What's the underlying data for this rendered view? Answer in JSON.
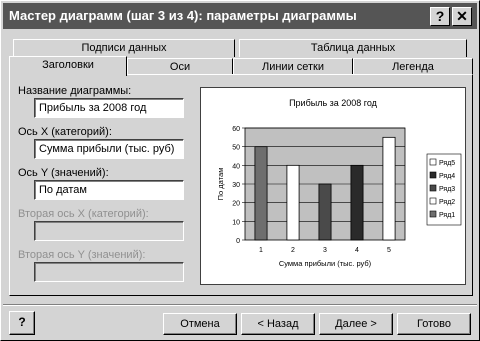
{
  "window": {
    "title": "Мастер диаграмм (шаг 3 из 4): параметры диаграммы",
    "help_btn": "?",
    "close_btn": "✕"
  },
  "tabs_back": [
    "Подписи данных",
    "Таблица данных"
  ],
  "tabs_front": [
    "Заголовки",
    "Оси",
    "Линии сетки",
    "Легенда"
  ],
  "fields": {
    "chart_title": {
      "label": "Название диаграммы:",
      "value": "Прибыль за 2008 год"
    },
    "x_axis": {
      "label": "Ось X (категорий):",
      "value": "Сумма прибыли (тыс. руб)"
    },
    "y_axis": {
      "label": "Ось Y (значений):",
      "value": "По датам"
    },
    "x2_axis": {
      "label": "Вторая ось X (категорий):",
      "value": ""
    },
    "y2_axis": {
      "label": "Вторая ось Y (значений):",
      "value": ""
    }
  },
  "chart_data": {
    "type": "bar",
    "title": "Прибыль за 2008 год",
    "xlabel": "Сумма прибыли (тыс. руб)",
    "ylabel": "По датам",
    "categories": [
      "1",
      "2",
      "3",
      "4",
      "5"
    ],
    "values": [
      50,
      40,
      30,
      40,
      55
    ],
    "ylim": [
      0,
      60
    ],
    "yticks": [
      "0",
      "10",
      "20",
      "30",
      "40",
      "50",
      "60"
    ],
    "bar_colors": [
      "#6e6e6e",
      "#ffffff",
      "#4a4a4a",
      "#2a2a2a",
      "#ffffff"
    ],
    "plot_bg": "#c0c0c0",
    "legend": [
      {
        "name": "Ряд5",
        "color": "#ffffff"
      },
      {
        "name": "Ряд4",
        "color": "#2a2a2a"
      },
      {
        "name": "Ряд3",
        "color": "#4a4a4a"
      },
      {
        "name": "Ряд2",
        "color": "#ffffff"
      },
      {
        "name": "Ряд1",
        "color": "#6e6e6e"
      }
    ],
    "legend_position": "right"
  },
  "buttons": {
    "help": "?",
    "cancel": "Отмена",
    "back": "< Назад",
    "next": "Далее >",
    "finish": "Готово"
  }
}
